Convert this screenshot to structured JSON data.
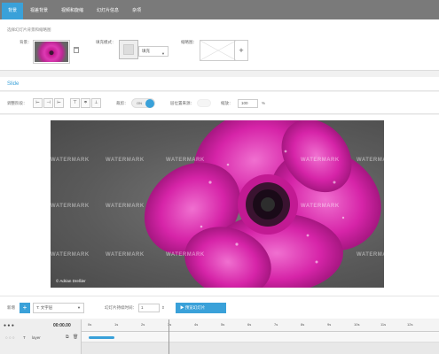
{
  "tabs": [
    {
      "label": "背景"
    },
    {
      "label": "视差背景"
    },
    {
      "label": "视频和旋缩"
    },
    {
      "label": "幻灯片信息"
    },
    {
      "label": "杂项"
    }
  ],
  "background": {
    "caption": "选择幻灯片背景和缩略图",
    "bg_label": "背景：",
    "fill_mode_label": "填充模式：",
    "fill_value": "填充",
    "thumb_label": "缩略图：",
    "plus": "+"
  },
  "slide": {
    "title": "Slide"
  },
  "toolbar": {
    "align_label": "调整阶段：",
    "crop_label": "裁剪：",
    "toggle_value": "ON",
    "parallax_label": "层位置来源：",
    "zoom_label": "缩放：",
    "zoom_value": "100",
    "zoom_unit": "%"
  },
  "image": {
    "watermark": "WATERMARK",
    "credit": "© Adrian Dreßler"
  },
  "bottombar": {
    "new_label": "新增",
    "plus": "+",
    "layer_type": "T: 文字层",
    "duration_label": "幻灯片持续时间：",
    "duration_value": "1",
    "preview_label": "预览幻灯片"
  },
  "timeline": {
    "timecode": "00:00.00",
    "layer_name": "layer",
    "ticks": [
      "0s",
      "1s",
      "2s",
      "3s",
      "4s",
      "5s",
      "6s",
      "7s",
      "8s",
      "9s",
      "10s",
      "11s",
      "12s"
    ]
  }
}
